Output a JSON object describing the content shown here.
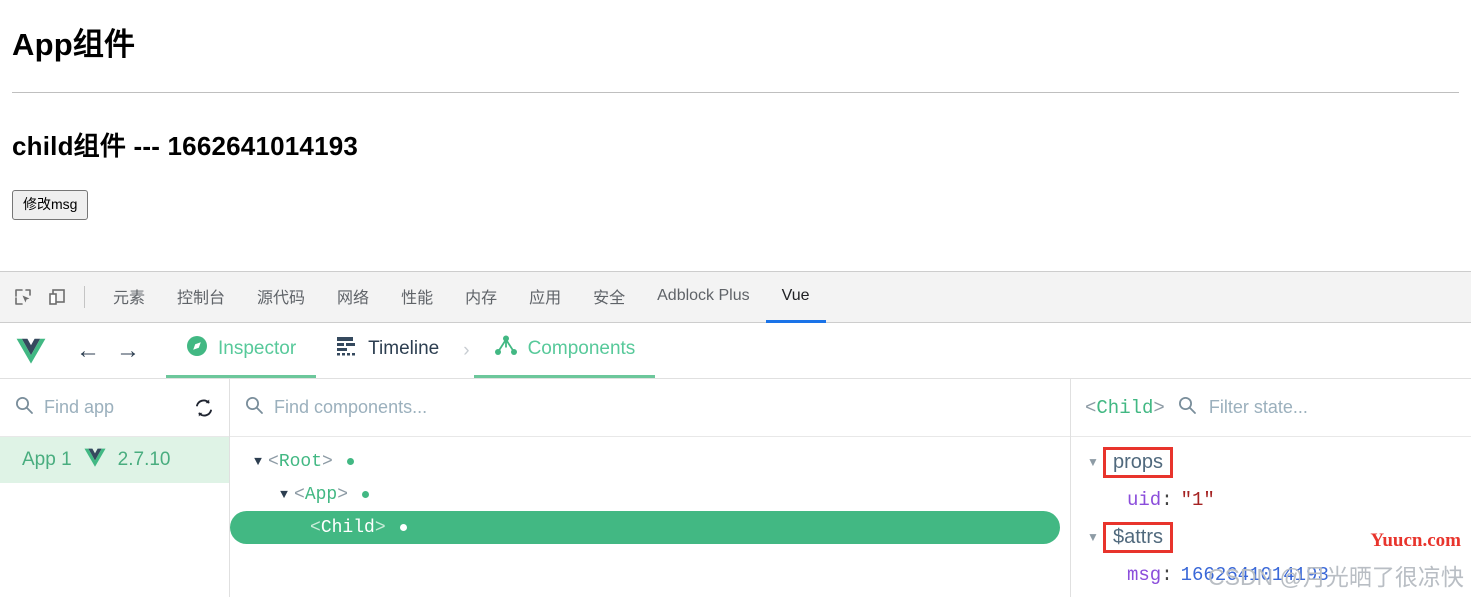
{
  "page": {
    "app_heading": "App组件",
    "child_heading": "child组件 --- 1662641014193",
    "modify_button": "修改msg"
  },
  "devtools": {
    "inspect_icon": "inspect-element-icon",
    "device_icon": "device-toolbar-icon",
    "tabs": [
      {
        "label": "元素",
        "active": false
      },
      {
        "label": "控制台",
        "active": false
      },
      {
        "label": "源代码",
        "active": false
      },
      {
        "label": "网络",
        "active": false
      },
      {
        "label": "性能",
        "active": false
      },
      {
        "label": "内存",
        "active": false
      },
      {
        "label": "应用",
        "active": false
      },
      {
        "label": "安全",
        "active": false
      },
      {
        "label": "Adblock Plus",
        "active": false
      },
      {
        "label": "Vue",
        "active": true
      }
    ],
    "active_tab_color": "#1a73e8"
  },
  "vue_toolbar": {
    "logo": "vue-logo",
    "back_arrow": "←",
    "forward_arrow": "→",
    "tabs": [
      {
        "label": "Inspector",
        "icon": "compass-icon",
        "active": true
      },
      {
        "label": "Timeline",
        "icon": "timeline-icon",
        "active": false
      },
      {
        "label": "Components",
        "icon": "components-tree-icon",
        "active": true
      }
    ],
    "chevron": "›",
    "accent_color": "#42b883"
  },
  "apps_pane": {
    "search_placeholder": "Find app",
    "refresh_icon": "refresh-icon",
    "app": {
      "name": "App 1",
      "version": "2.7.10",
      "logo": "vue-logo"
    }
  },
  "tree_pane": {
    "search_placeholder": "Find components...",
    "nodes": [
      {
        "name": "Root",
        "depth": 0,
        "expanded": true,
        "selected": false,
        "has_dot": true
      },
      {
        "name": "App",
        "depth": 1,
        "expanded": true,
        "selected": false,
        "has_dot": true
      },
      {
        "name": "Child",
        "depth": 2,
        "expanded": false,
        "selected": true,
        "has_dot": true
      }
    ]
  },
  "state_pane": {
    "component": "<Child>",
    "component_open": "<",
    "component_name": "Child",
    "component_close": ">",
    "filter_placeholder": "Filter state...",
    "groups": [
      {
        "label": "props",
        "expanded": true,
        "highlighted": true,
        "entries": [
          {
            "key": "uid",
            "value": "\"1\"",
            "type": "string"
          }
        ]
      },
      {
        "label": "$attrs",
        "expanded": true,
        "highlighted": true,
        "entries": [
          {
            "key": "msg",
            "value": "1662641014193",
            "type": "number"
          }
        ]
      }
    ],
    "highlight_color": "#e8342c"
  },
  "watermarks": {
    "yuucn": "Yuucn.com",
    "csdn": "CSDN @月光晒了很凉快"
  }
}
